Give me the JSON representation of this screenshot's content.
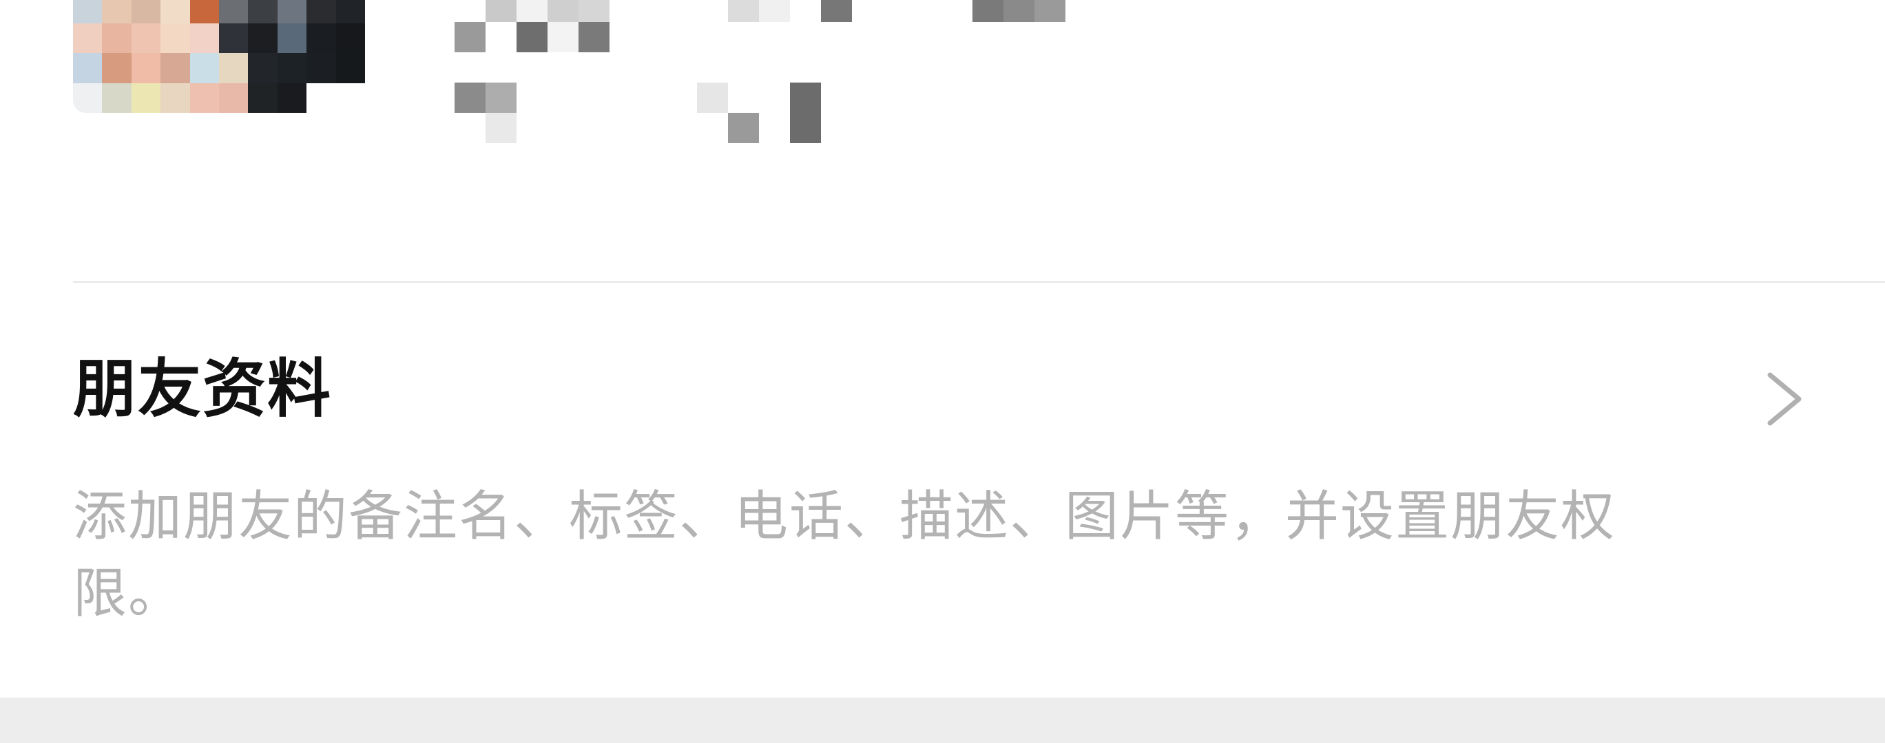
{
  "contact_card": {
    "avatar_icon": "avatar-censored-mosaic",
    "name": "",
    "id": ""
  },
  "friend_profile": {
    "title": "朋友资料",
    "description": "添加朋友的备注名、标签、电话、描述、图片等，并设置朋友权限。",
    "chevron_icon": "chevron-right-icon"
  },
  "colors": {
    "background": "#ffffff",
    "title": "#111111",
    "description": "#b3b3b3",
    "divider": "#e6e6e6",
    "chevron": "#b0b0b0",
    "bottom_band": "#ededed"
  }
}
